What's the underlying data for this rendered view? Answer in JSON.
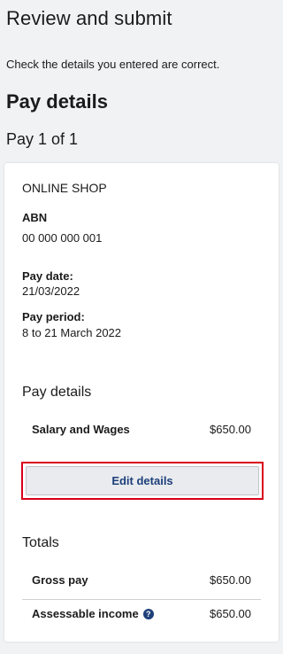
{
  "header": {
    "title": "Review and submit",
    "intro": "Check the details you entered are correct.",
    "section_title": "Pay details",
    "pay_count": "Pay 1 of 1"
  },
  "card": {
    "employer": "ONLINE SHOP",
    "abn_label": "ABN",
    "abn_value": "00 000 000 001",
    "pay_date_label": "Pay date:",
    "pay_date_value": "21/03/2022",
    "pay_period_label": "Pay period:",
    "pay_period_value": "8 to 21 March 2022",
    "pay_details_heading": "Pay details",
    "salary_label": "Salary and Wages",
    "salary_amount": "$650.00",
    "edit_button": "Edit details",
    "totals_heading": "Totals",
    "gross_label": "Gross pay",
    "gross_amount": "$650.00",
    "assessable_label": "Assessable income",
    "assessable_amount": "$650.00"
  },
  "icons": {
    "help": "question-circle-icon"
  },
  "colors": {
    "accent": "#1d3f7a",
    "highlight": "#d9001b",
    "background": "#f1f2f4"
  }
}
